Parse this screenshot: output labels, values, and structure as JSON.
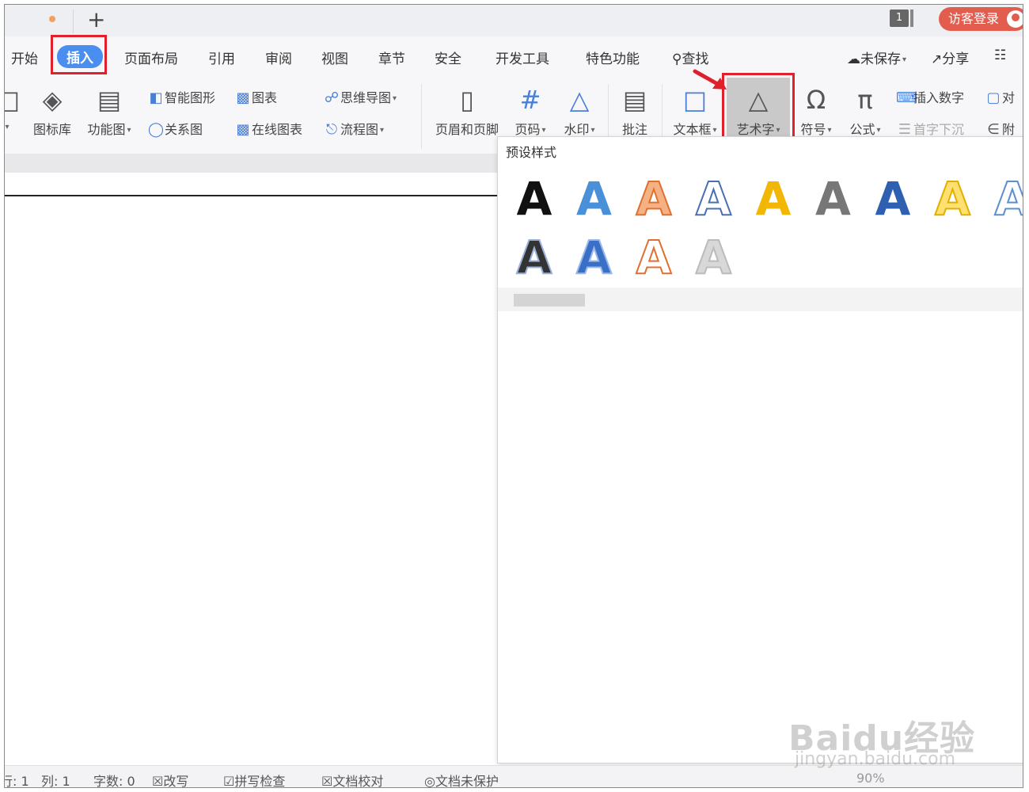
{
  "titlebar": {
    "plus": "+",
    "window_count": "1",
    "guest_login": "访客登录"
  },
  "menu": {
    "items": [
      "开始",
      "插入",
      "页面布局",
      "引用",
      "审阅",
      "视图",
      "章节",
      "安全",
      "开发工具",
      "特色功能"
    ],
    "search": "查找",
    "unsaved": "未保存",
    "share": "分享"
  },
  "ribbon": {
    "icon_library": "图标库",
    "function_chart": "功能图",
    "smart_art": "智能图形",
    "chart": "图表",
    "relation_chart": "关系图",
    "online_chart": "在线图表",
    "mind_map": "思维导图",
    "flow_chart": "流程图",
    "header_footer": "页眉和页脚",
    "page_number": "页码",
    "watermark": "水印",
    "comment": "批注",
    "text_box": "文本框",
    "word_art": "艺术字",
    "symbol": "符号",
    "formula": "公式",
    "insert_number": "插入数字",
    "drop_cap": "首字下沉",
    "partial_right1": "对",
    "partial_right2": "附"
  },
  "wordart_panel": {
    "header": "预设样式",
    "glyph": "A",
    "styles": [
      {
        "fill": "#111111",
        "stroke": "none"
      },
      {
        "fill": "#4a90d9",
        "stroke": "none"
      },
      {
        "fill": "#f4b183",
        "stroke": "#e07030"
      },
      {
        "fill": "#ffffff",
        "stroke": "#4a6fb5"
      },
      {
        "fill": "#f2b705",
        "stroke": "none"
      },
      {
        "fill": "#777777",
        "stroke": "none"
      },
      {
        "fill": "#2e5fb0",
        "stroke": "none"
      },
      {
        "fill": "#ffe070",
        "stroke": "#e0b000"
      },
      {
        "fill": "#ffffff",
        "stroke": "#5a8fd0"
      },
      {
        "fill": "#333333",
        "stroke": "#9ab0d8"
      },
      {
        "fill": "#3a6fc8",
        "stroke": "#9ab8e8"
      },
      {
        "fill": "#ffffff",
        "stroke": "#e07030"
      },
      {
        "fill": "#d8d8d8",
        "stroke": "#bbbbbb"
      }
    ]
  },
  "status": {
    "row": "行: 1",
    "col": "列: 1",
    "chars": "字数: 0",
    "overwrite": "改写",
    "spell": "拼写检查",
    "proofread": "文档校对",
    "protect": "文档未保护",
    "zoom": "90%"
  },
  "watermark": {
    "brand": "Baidu经验",
    "url": "jingyan.baidu.com"
  }
}
